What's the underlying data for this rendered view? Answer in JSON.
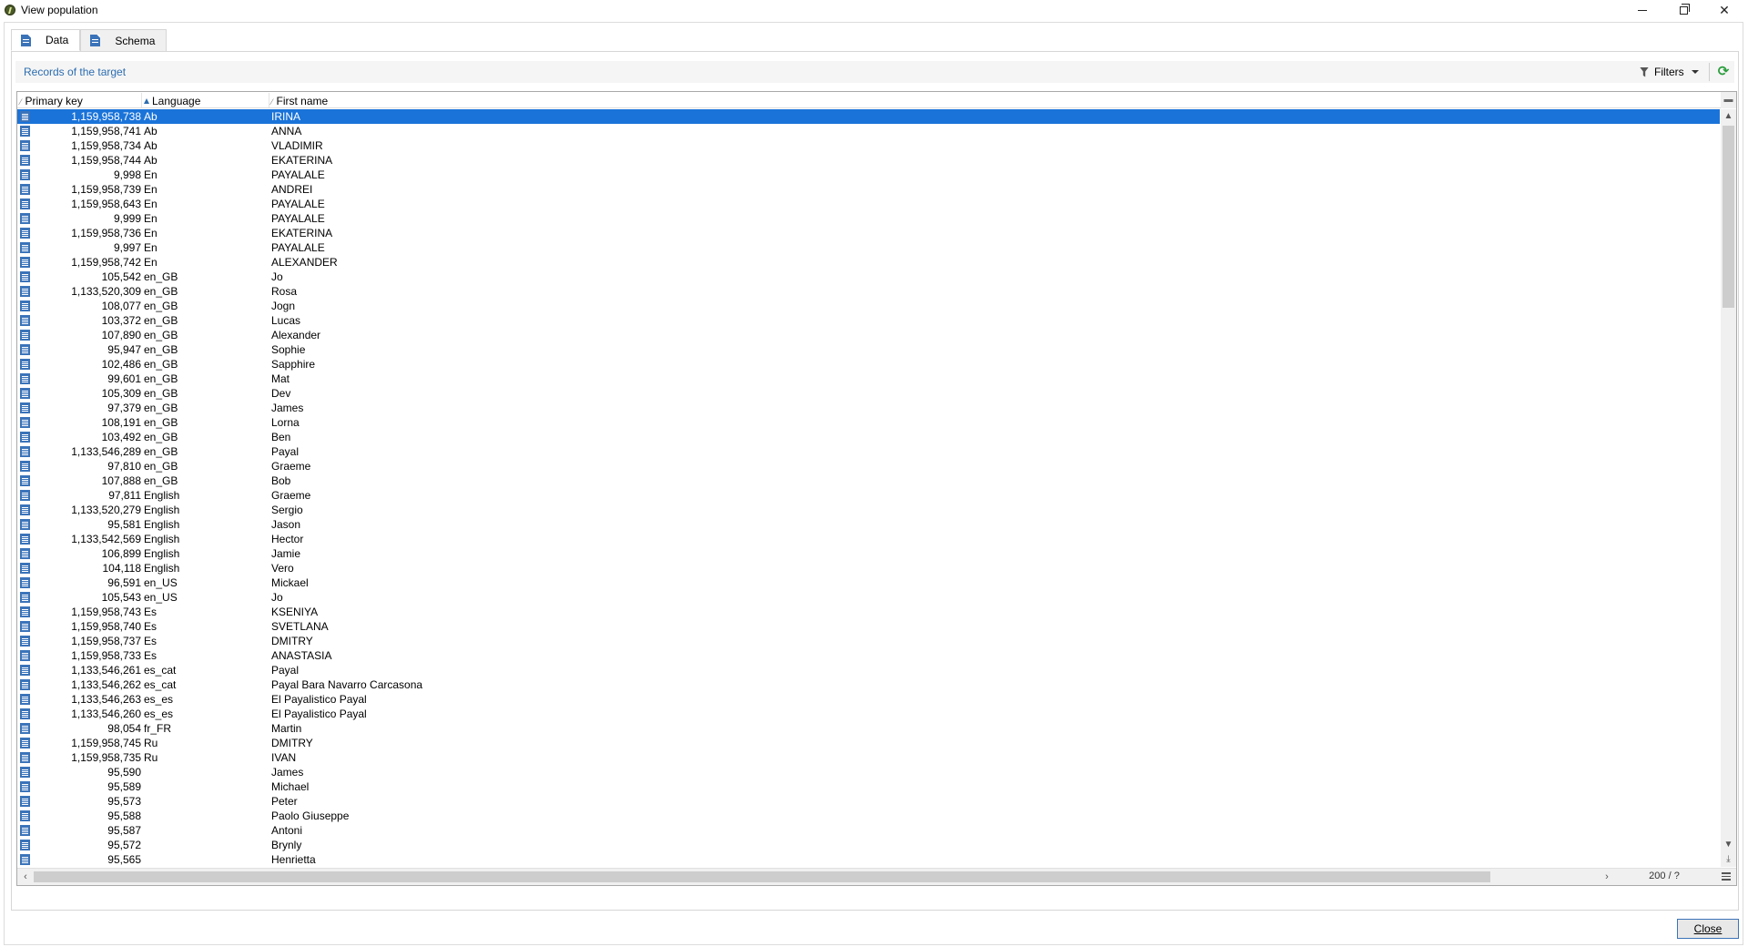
{
  "window": {
    "title": "View population",
    "minimize_label": "",
    "maximize_label": "",
    "close_symbol": "✕"
  },
  "tabs": [
    {
      "label": "Data",
      "icon": "data-sheet-icon",
      "active": true
    },
    {
      "label": "Schema",
      "icon": "schema-sheet-icon",
      "active": false
    }
  ],
  "panel": {
    "records_label": "Records of the target",
    "filters_label": "Filters",
    "refresh_icon": "refresh-icon"
  },
  "grid": {
    "columns": [
      "Primary key",
      "Language",
      "First name"
    ],
    "sorted_column": "Language",
    "counter": "200 / ?",
    "rows": [
      {
        "pk": "1,159,958,738",
        "lang": "Ab",
        "fname": "IRINA"
      },
      {
        "pk": "1,159,958,741",
        "lang": "Ab",
        "fname": "ANNA"
      },
      {
        "pk": "1,159,958,734",
        "lang": "Ab",
        "fname": "VLADIMIR"
      },
      {
        "pk": "1,159,958,744",
        "lang": "Ab",
        "fname": "EKATERINA"
      },
      {
        "pk": "9,998",
        "lang": "En",
        "fname": "PAYALALE"
      },
      {
        "pk": "1,159,958,739",
        "lang": "En",
        "fname": "ANDREI"
      },
      {
        "pk": "1,159,958,643",
        "lang": "En",
        "fname": "PAYALALE"
      },
      {
        "pk": "9,999",
        "lang": "En",
        "fname": "PAYALALE"
      },
      {
        "pk": "1,159,958,736",
        "lang": "En",
        "fname": "EKATERINA"
      },
      {
        "pk": "9,997",
        "lang": "En",
        "fname": "PAYALALE"
      },
      {
        "pk": "1,159,958,742",
        "lang": "En",
        "fname": "ALEXANDER"
      },
      {
        "pk": "105,542",
        "lang": "en_GB",
        "fname": "Jo"
      },
      {
        "pk": "1,133,520,309",
        "lang": "en_GB",
        "fname": "Rosa"
      },
      {
        "pk": "108,077",
        "lang": "en_GB",
        "fname": "Jogn"
      },
      {
        "pk": "103,372",
        "lang": "en_GB",
        "fname": "Lucas"
      },
      {
        "pk": "107,890",
        "lang": "en_GB",
        "fname": "Alexander"
      },
      {
        "pk": "95,947",
        "lang": "en_GB",
        "fname": "Sophie"
      },
      {
        "pk": "102,486",
        "lang": "en_GB",
        "fname": "Sapphire"
      },
      {
        "pk": "99,601",
        "lang": "en_GB",
        "fname": "Mat"
      },
      {
        "pk": "105,309",
        "lang": "en_GB",
        "fname": "Dev"
      },
      {
        "pk": "97,379",
        "lang": "en_GB",
        "fname": "James"
      },
      {
        "pk": "108,191",
        "lang": "en_GB",
        "fname": "Lorna"
      },
      {
        "pk": "103,492",
        "lang": "en_GB",
        "fname": "Ben"
      },
      {
        "pk": "1,133,546,289",
        "lang": "en_GB",
        "fname": "Payal"
      },
      {
        "pk": "97,810",
        "lang": "en_GB",
        "fname": "Graeme"
      },
      {
        "pk": "107,888",
        "lang": "en_GB",
        "fname": "Bob"
      },
      {
        "pk": "97,811",
        "lang": "English",
        "fname": "Graeme"
      },
      {
        "pk": "1,133,520,279",
        "lang": "English",
        "fname": "Sergio"
      },
      {
        "pk": "95,581",
        "lang": "English",
        "fname": "Jason"
      },
      {
        "pk": "1,133,542,569",
        "lang": "English",
        "fname": "Hector"
      },
      {
        "pk": "106,899",
        "lang": "English",
        "fname": "Jamie"
      },
      {
        "pk": "104,118",
        "lang": "English",
        "fname": "Vero"
      },
      {
        "pk": "96,591",
        "lang": "en_US",
        "fname": "Mickael"
      },
      {
        "pk": "105,543",
        "lang": "en_US",
        "fname": "Jo"
      },
      {
        "pk": "1,159,958,743",
        "lang": "Es",
        "fname": "KSENIYA"
      },
      {
        "pk": "1,159,958,740",
        "lang": "Es",
        "fname": "SVETLANA"
      },
      {
        "pk": "1,159,958,737",
        "lang": "Es",
        "fname": "DMITRY"
      },
      {
        "pk": "1,159,958,733",
        "lang": "Es",
        "fname": "ANASTASIA"
      },
      {
        "pk": "1,133,546,261",
        "lang": "es_cat",
        "fname": "Payal"
      },
      {
        "pk": "1,133,546,262",
        "lang": "es_cat",
        "fname": "Payal Bara Navarro Carcasona"
      },
      {
        "pk": "1,133,546,263",
        "lang": "es_es",
        "fname": "El Payalistico Payal"
      },
      {
        "pk": "1,133,546,260",
        "lang": "es_es",
        "fname": "El Payalistico Payal"
      },
      {
        "pk": "98,054",
        "lang": "fr_FR",
        "fname": "Martin"
      },
      {
        "pk": "1,159,958,745",
        "lang": "Ru",
        "fname": "DMITRY"
      },
      {
        "pk": "1,159,958,735",
        "lang": "Ru",
        "fname": "IVAN"
      },
      {
        "pk": "95,590",
        "lang": "",
        "fname": "James"
      },
      {
        "pk": "95,589",
        "lang": "",
        "fname": "Michael"
      },
      {
        "pk": "95,573",
        "lang": "",
        "fname": "Peter"
      },
      {
        "pk": "95,588",
        "lang": "",
        "fname": "Paolo Giuseppe"
      },
      {
        "pk": "95,587",
        "lang": "",
        "fname": "Antoni"
      },
      {
        "pk": "95,572",
        "lang": "",
        "fname": "Brynly"
      },
      {
        "pk": "95,565",
        "lang": "",
        "fname": "Henrietta"
      }
    ]
  },
  "footer": {
    "close_label": "Close"
  },
  "colors": {
    "accent": "#1a73d9",
    "link_text": "#2c6db0",
    "row_icon": "#3b73b9",
    "refresh": "#2a9d3c"
  }
}
